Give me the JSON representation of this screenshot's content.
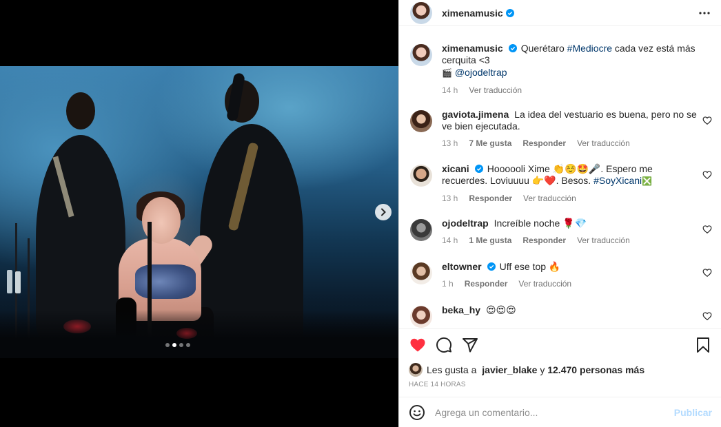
{
  "post": {
    "author": "ximenamusic",
    "more_icon": "more-horizontal-icon",
    "carousel": {
      "slides": 4,
      "active_slide": 2
    }
  },
  "caption": {
    "username": "ximenamusic",
    "text_before": "Querétaro ",
    "hashtag": "#Mediocre",
    "text_after": " cada vez está más cerquita <3",
    "credit_emoji": "🎬",
    "credit_handle": "@ojodeltrap",
    "time": "14 h",
    "translate": "Ver traducción"
  },
  "comments": [
    {
      "username": "gaviota.jimena",
      "verified": false,
      "text": "La idea del vestuario es buena, pero no se ve bien ejecutada.",
      "time": "13 h",
      "likes": "7 Me gusta",
      "reply": "Responder",
      "translate": "Ver traducción"
    },
    {
      "username": "xicani",
      "verified": true,
      "text": "Hoooooli Xime 👏☺️🤩🎤. Espero me recuerdes. Loviuuuu 👉❤️. Besos.",
      "hashtag": "#SoyXicani",
      "hashtag_emoji": "❎",
      "time": "13 h",
      "reply": "Responder",
      "translate": "Ver traducción"
    },
    {
      "username": "ojodeltrap",
      "verified": false,
      "text": "Increíble noche 🌹💎",
      "time": "14 h",
      "likes": "1 Me gusta",
      "reply": "Responder",
      "translate": "Ver traducción"
    },
    {
      "username": "eltowner",
      "verified": true,
      "text": "Uff ese top 🔥",
      "time": "1 h",
      "reply": "Responder",
      "translate": "Ver traducción"
    },
    {
      "username": "beka_hy",
      "verified": false,
      "text": "😍😍😍"
    }
  ],
  "likes": {
    "prefix": "Les gusta a ",
    "user": "javier_blake",
    "middle": " y ",
    "count": "12.470 personas más"
  },
  "timestamp": "HACE 14 HORAS",
  "comment_box": {
    "placeholder": "Agrega un comentario...",
    "publish": "Publicar"
  },
  "colors": {
    "like_red": "#ff3040",
    "verified_blue": "#0095f6",
    "link_blue": "#00376b",
    "publish_disabled": "#b3dbff"
  }
}
